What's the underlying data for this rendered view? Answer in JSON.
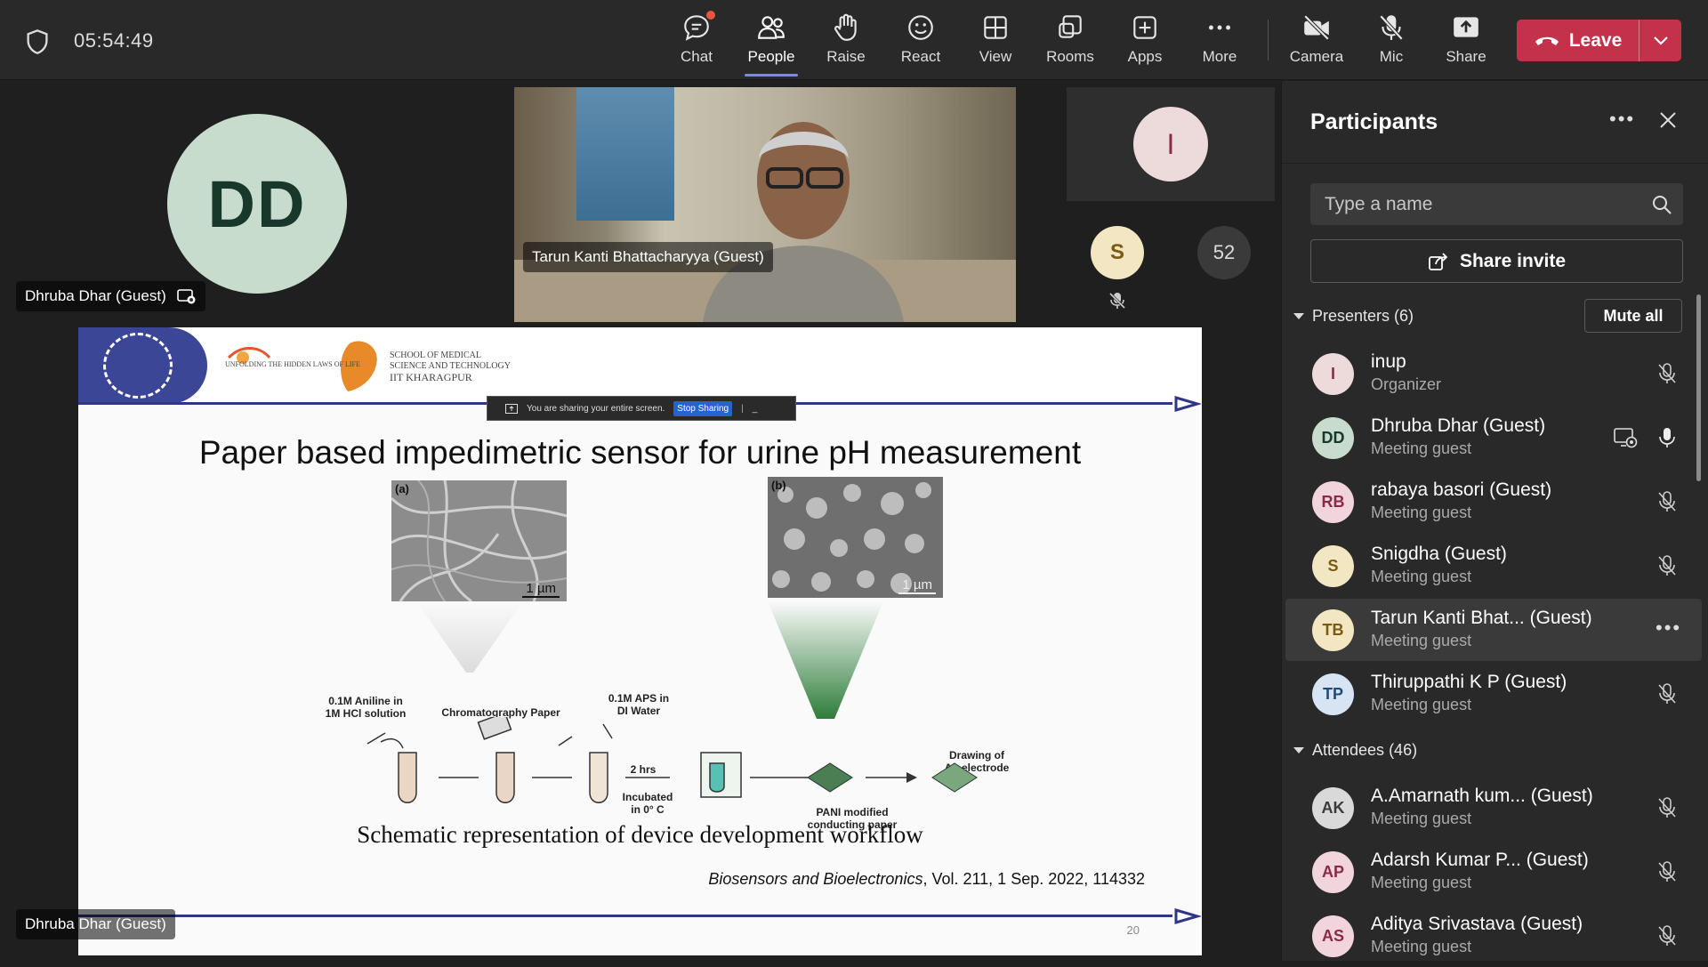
{
  "meeting": {
    "time": "05:54:49"
  },
  "toolbar": {
    "chat": "Chat",
    "people": "People",
    "raise": "Raise",
    "react": "React",
    "view": "View",
    "rooms": "Rooms",
    "apps": "Apps",
    "more": "More",
    "camera": "Camera",
    "mic": "Mic",
    "share": "Share",
    "leave": "Leave"
  },
  "stage": {
    "dd_initials": "DD",
    "dd_name": "Dhruba Dhar (Guest)",
    "video_name": "Tarun Kanti Bhattacharyya (Guest)",
    "i_initial": "I",
    "s_initial": "S",
    "more_count": "52",
    "screen_share_name": "Dhruba Dhar (Guest)"
  },
  "slide": {
    "smst_line1": "SCHOOL OF MEDICAL",
    "smst_line2": "SCIENCE AND TECHNOLOGY",
    "smst_line3": "IIT KHARAGPUR",
    "smst_tagline": "UNFOLDING THE HIDDEN LAWS OF LIFE",
    "share_notice": "You are sharing your entire screen.",
    "stop_sharing": "Stop Sharing",
    "title": "Paper based impedimetric sensor for urine pH measurement",
    "sem_a_label": "(a)",
    "sem_a_scale": "1 µm",
    "sem_b_label": "(b)",
    "sem_b_scale": "1 µm",
    "label_aniline": "0.1M Aniline in\n1M HCl solution",
    "label_paper": "Chromatography Paper",
    "label_aps": "0.1M APS in\nDI Water",
    "label_hrs": "2 hrs",
    "label_incubated": "Incubated\nin 0° C",
    "label_pani": "PANI modified\nconducting paper",
    "label_drawing": "Drawing of\nAg electrode",
    "caption": "Schematic representation of device development workflow",
    "citation_journal": "Biosensors and Bioelectronics",
    "citation_rest": ", Vol. 211, 1 Sep. 2022, 114332",
    "page_number": "20"
  },
  "panel": {
    "title": "Participants",
    "search_placeholder": "Type a name",
    "share_invite": "Share invite",
    "presenters_label": "Presenters (6)",
    "mute_all": "Mute all",
    "attendees_label": "Attendees (46)",
    "presenters": [
      {
        "initials": "I",
        "name": "inup",
        "role": "Organizer",
        "bg": "#eddada",
        "fg": "#8a2b45"
      },
      {
        "initials": "DD",
        "name": "Dhruba Dhar (Guest)",
        "role": "Meeting guest",
        "bg": "#c8dccd",
        "fg": "#17382a"
      },
      {
        "initials": "RB",
        "name": "rabaya basori (Guest)",
        "role": "Meeting guest",
        "bg": "#f2d4dc",
        "fg": "#8a2b45"
      },
      {
        "initials": "S",
        "name": "Snigdha (Guest)",
        "role": "Meeting guest",
        "bg": "#f3e6c2",
        "fg": "#7a5b13"
      },
      {
        "initials": "TB",
        "name": "Tarun Kanti Bhat...  (Guest)",
        "role": "Meeting guest",
        "bg": "#f3e6c2",
        "fg": "#7a5b13"
      },
      {
        "initials": "TP",
        "name": "Thiruppathi K P (Guest)",
        "role": "Meeting guest",
        "bg": "#d6e4f3",
        "fg": "#1f4a7a"
      }
    ],
    "attendees": [
      {
        "initials": "AK",
        "name": "A.Amarnath kum...  (Guest)",
        "role": "Meeting guest",
        "bg": "#d9d9d9",
        "fg": "#3b3b3b"
      },
      {
        "initials": "AP",
        "name": "Adarsh Kumar P...  (Guest)",
        "role": "Meeting guest",
        "bg": "#f2d4dc",
        "fg": "#8a2b45"
      },
      {
        "initials": "AS",
        "name": "Aditya Srivastava (Guest)",
        "role": "Meeting guest",
        "bg": "#f2d4dc",
        "fg": "#8a2b45"
      }
    ]
  }
}
